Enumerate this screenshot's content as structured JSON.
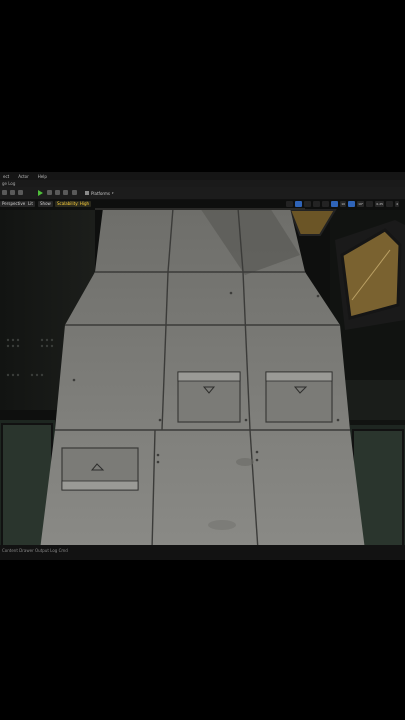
{
  "menubar": {
    "items": [
      "ect",
      "Actor",
      "Help"
    ]
  },
  "tab": {
    "label": "ge Log"
  },
  "toolbar": {
    "platforms_label": "Platforms"
  },
  "viewport": {
    "mode_label": "Perspective",
    "lit_label": "Lit",
    "show_label": "Show",
    "scalability_label": "Scalability: High",
    "grid_snap_value": "10",
    "rotation_snap_value": "10°",
    "scale_snap_value": "0.25",
    "camera_speed_value": "4"
  },
  "statusbar": {
    "text": "Content Drawer  Output Log  Cmd"
  },
  "colors": {
    "accent_blue": "#2f64b8",
    "play_green": "#4fbf3a",
    "warning_yellow": "#ffd13a"
  }
}
